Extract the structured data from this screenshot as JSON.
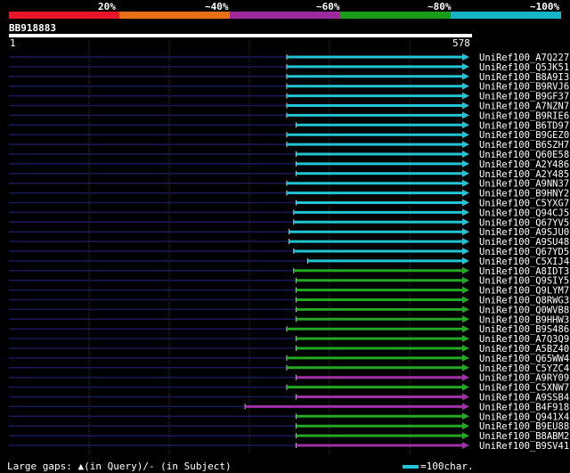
{
  "legend": [
    {
      "label": "",
      "color": "#e8162b"
    },
    {
      "label": "20%",
      "color": "#e87018"
    },
    {
      "label": "~40%",
      "color": "#9c2a9c"
    },
    {
      "label": "~60%",
      "color": "#1a9c1a"
    },
    {
      "label": "~80%",
      "color": "#16b4c4"
    },
    {
      "label": "~100%",
      "color": "#16b4c4"
    }
  ],
  "query": {
    "name": "BB918883",
    "start": "1",
    "end": "578"
  },
  "colors": {
    "cyan": "#22c4d4",
    "green": "#22a822",
    "magenta": "#a032a8",
    "line": "#1a1a5a",
    "grid": "#303030"
  },
  "hits": [
    {
      "label": "UniRef100_A7Q227",
      "start": 0.6,
      "color": "cyan"
    },
    {
      "label": "UniRef100_Q5JK51",
      "start": 0.6,
      "color": "cyan"
    },
    {
      "label": "UniRef100_B8A9I3",
      "start": 0.6,
      "color": "cyan"
    },
    {
      "label": "UniRef100_B9RVJ6",
      "start": 0.6,
      "color": "cyan"
    },
    {
      "label": "UniRef100_B9GF37",
      "start": 0.6,
      "color": "cyan"
    },
    {
      "label": "UniRef100_A7NZN7",
      "start": 0.6,
      "color": "cyan"
    },
    {
      "label": "UniRef100_B9RIE6",
      "start": 0.6,
      "color": "cyan"
    },
    {
      "label": "UniRef100_B6TD97",
      "start": 0.62,
      "color": "cyan"
    },
    {
      "label": "UniRef100_B9GEZ0",
      "start": 0.6,
      "color": "cyan"
    },
    {
      "label": "UniRef100_B6SZH7",
      "start": 0.6,
      "color": "cyan"
    },
    {
      "label": "UniRef100_Q60E58",
      "start": 0.62,
      "color": "cyan"
    },
    {
      "label": "UniRef100_A2Y486",
      "start": 0.62,
      "color": "cyan"
    },
    {
      "label": "UniRef100_A2Y485",
      "start": 0.62,
      "color": "cyan"
    },
    {
      "label": "UniRef100_A9NN37",
      "start": 0.6,
      "color": "cyan"
    },
    {
      "label": "UniRef100_B9HNY2",
      "start": 0.6,
      "color": "cyan"
    },
    {
      "label": "UniRef100_C5YXG7",
      "start": 0.62,
      "color": "cyan"
    },
    {
      "label": "UniRef100_Q94CJ5",
      "start": 0.615,
      "color": "cyan"
    },
    {
      "label": "UniRef100_Q67YV5",
      "start": 0.615,
      "color": "cyan"
    },
    {
      "label": "UniRef100_A9SJU0",
      "start": 0.605,
      "color": "cyan"
    },
    {
      "label": "UniRef100_A9SU48",
      "start": 0.605,
      "color": "cyan"
    },
    {
      "label": "UniRef100_Q67YD5",
      "start": 0.615,
      "color": "cyan"
    },
    {
      "label": "UniRef100_C5XIJ4",
      "start": 0.645,
      "color": "cyan"
    },
    {
      "label": "UniRef100_A8IDT3",
      "start": 0.615,
      "color": "green"
    },
    {
      "label": "UniRef100_Q9SIY5",
      "start": 0.62,
      "color": "green"
    },
    {
      "label": "UniRef100_Q9LYM7",
      "start": 0.62,
      "color": "green"
    },
    {
      "label": "UniRef100_Q8RWG3",
      "start": 0.62,
      "color": "green"
    },
    {
      "label": "UniRef100_Q0WVB8",
      "start": 0.62,
      "color": "green"
    },
    {
      "label": "UniRef100_B9HHW3",
      "start": 0.62,
      "color": "green"
    },
    {
      "label": "UniRef100_B9S486",
      "start": 0.6,
      "color": "green"
    },
    {
      "label": "UniRef100_A7Q3Q9",
      "start": 0.62,
      "color": "green"
    },
    {
      "label": "UniRef100_A5BZ40",
      "start": 0.62,
      "color": "green"
    },
    {
      "label": "UniRef100_Q65WW4",
      "start": 0.6,
      "color": "green"
    },
    {
      "label": "UniRef100_C5YZC4",
      "start": 0.6,
      "color": "green"
    },
    {
      "label": "UniRef100_A9RY09",
      "start": 0.62,
      "color": "magenta"
    },
    {
      "label": "UniRef100_C5XNW7",
      "start": 0.6,
      "color": "green"
    },
    {
      "label": "UniRef100_A9SSB4",
      "start": 0.62,
      "color": "magenta"
    },
    {
      "label": "UniRef100_B4F918",
      "start": 0.51,
      "color": "magenta"
    },
    {
      "label": "UniRef100_Q941X4",
      "start": 0.62,
      "color": "green"
    },
    {
      "label": "UniRef100_B9EU88",
      "start": 0.62,
      "color": "green"
    },
    {
      "label": "UniRef100_B8ABM2",
      "start": 0.62,
      "color": "green"
    },
    {
      "label": "UniRef100_B9SV41",
      "start": 0.62,
      "color": "magenta"
    }
  ],
  "footer": {
    "gaps": "Large gaps: ▲(in Query)/- (in Subject)",
    "scale": "=100char."
  }
}
